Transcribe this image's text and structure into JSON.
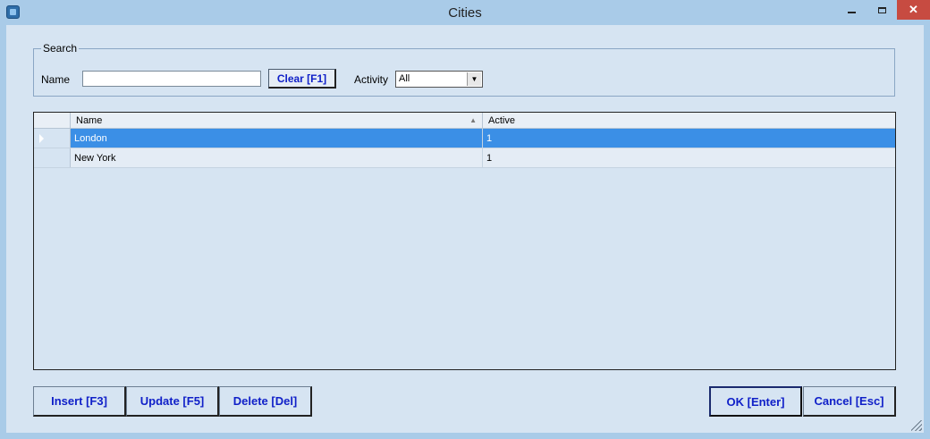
{
  "window": {
    "title": "Cities",
    "min_glyph": "",
    "max_glyph": "",
    "close_glyph": "✕"
  },
  "search": {
    "legend": "Search",
    "name_label": "Name",
    "name_value": "",
    "clear_label": "Clear [F1]",
    "activity_label": "Activity",
    "activity_selected": "All"
  },
  "grid": {
    "columns": [
      "Name",
      "Active"
    ],
    "rows": [
      {
        "name": "London",
        "active": "1",
        "selected": true
      },
      {
        "name": "New York",
        "active": "1",
        "selected": false
      }
    ]
  },
  "actions": {
    "insert": "Insert [F3]",
    "update": "Update [F5]",
    "delete": "Delete [Del]",
    "ok": "OK [Enter]",
    "cancel": "Cancel [Esc]"
  },
  "icons": {
    "app": "app-icon",
    "sort": "sort-ascending-icon",
    "row_pointer": "row-pointer-icon"
  },
  "colors": {
    "accent_button_text": "#1020c8",
    "selected_row": "#3b8fe6",
    "close_button": "#c74b41"
  }
}
